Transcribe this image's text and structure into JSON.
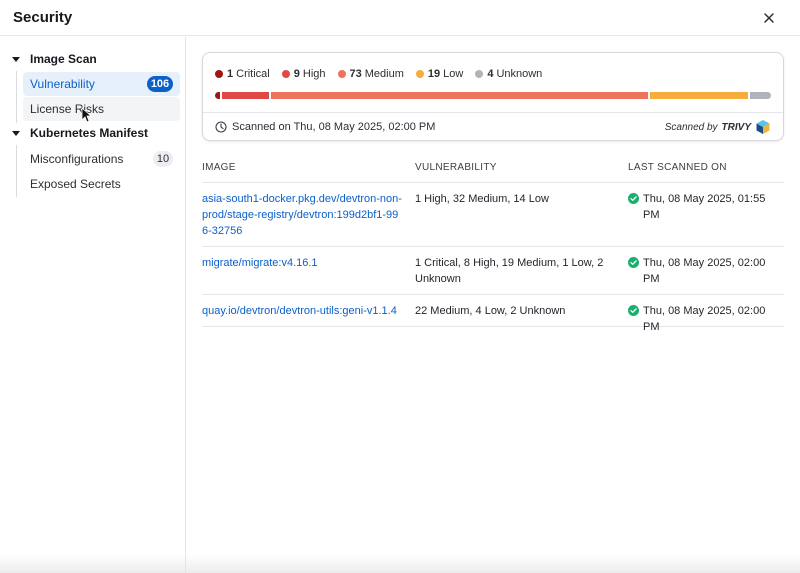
{
  "header": {
    "title": "Security",
    "close_icon": "close-icon"
  },
  "sidebar": {
    "groups": [
      {
        "label": "Image Scan",
        "items": [
          {
            "label": "Vulnerability",
            "count": "106",
            "active": true
          },
          {
            "label": "License Risks"
          }
        ]
      },
      {
        "label": "Kubernetes Manifest",
        "items": [
          {
            "label": "Misconfigurations",
            "count": "10"
          },
          {
            "label": "Exposed Secrets"
          }
        ]
      }
    ]
  },
  "summary": {
    "legend": [
      {
        "count": "1",
        "label": "Critical",
        "color": "#a31515"
      },
      {
        "count": "9",
        "label": "High",
        "color": "#e04848"
      },
      {
        "count": "73",
        "label": "Medium",
        "color": "#ef735a"
      },
      {
        "count": "19",
        "label": "Low",
        "color": "#f5ad3d"
      },
      {
        "count": "4",
        "label": "Unknown",
        "color": "#b0b4ba"
      }
    ],
    "bar_values": [
      1,
      9,
      73,
      19,
      4
    ],
    "scanned_on": "Scanned on Thu, 08 May 2025, 02:00 PM",
    "scanned_by": "Scanned by",
    "scanner": "TRIVY"
  },
  "table": {
    "headers": {
      "image": "IMAGE",
      "vulnerability": "VULNERABILITY",
      "last_scanned": "LAST SCANNED ON"
    },
    "rows": [
      {
        "image": "asia-south1-docker.pkg.dev/devtron-non-prod/stage-registry/devtron:199d2bf1-996-32756",
        "vulnerability": "1 High, 32 Medium, 14 Low",
        "last_scanned": "Thu, 08 May 2025, 01:55 PM"
      },
      {
        "image": "migrate/migrate:v4.16.1",
        "vulnerability": "1 Critical, 8 High, 19 Medium, 1 Low, 2 Unknown",
        "last_scanned": "Thu, 08 May 2025, 02:00 PM"
      },
      {
        "image": "quay.io/devtron/devtron-utils:geni-v1.1.4",
        "vulnerability": "22 Medium, 4 Low, 2 Unknown",
        "last_scanned": "Thu, 08 May 2025, 02:00 PM"
      }
    ]
  },
  "colors": {
    "accent": "#0b60c9",
    "success": "#1dad70"
  }
}
